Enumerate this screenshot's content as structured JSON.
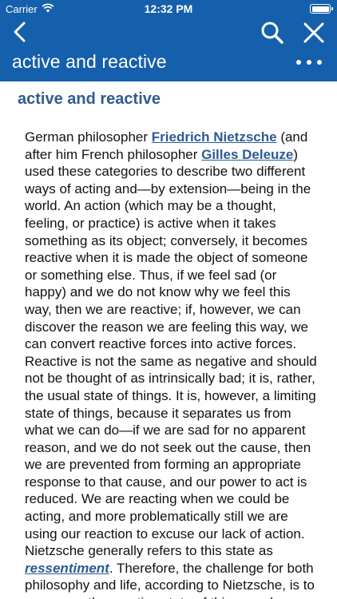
{
  "status_bar": {
    "carrier": "Carrier",
    "time": "12:32 PM",
    "battery_level": 1.0
  },
  "header": {
    "title": "active and reactive",
    "icons": {
      "back": "chevron-left-icon",
      "search": "search-icon",
      "close": "close-icon",
      "more": "more-dots-icon"
    },
    "background_color": "#1560ac"
  },
  "entry": {
    "title": "active and reactive",
    "title_color": "#2f5c8e",
    "body": {
      "p1": "German philosopher ",
      "link1": "Friedrich Nietzsche",
      "p2": " (and after him French philosopher ",
      "link2": "Gilles Deleuze",
      "p3": ") used these categories to describe two different ways of acting and—by extension—being in the world. An action (which may be a thought, feeling, or practice) is active when it takes something as its object; conversely, it becomes reactive when it is made the object of someone or something else. Thus, if we feel sad (or happy) and we do not know why we feel this way, then we are reactive; if, however, we can discover the reason we are feeling this way, we can convert reactive forces into active forces. Reactive is not the same as negative and should not be thought of as intrinsically bad; it is, rather, the usual state of things. It is, however, a limiting state of things, because it separates us from what we can do—if we are sad for no apparent reason, and we do not seek out the cause, then we are prevented from forming an appropriate response to that cause, and our power to act is reduced. We are reacting when we could be acting, and more problematically still we are using our reaction to excuse our lack of action. Nietzsche generally refers to this state as ",
      "link3": "ressentiment",
      "p4": ". Therefore, the challenge for both philosophy and life, according to Nietzsche, is to overcome the reactive state of things and"
    }
  }
}
